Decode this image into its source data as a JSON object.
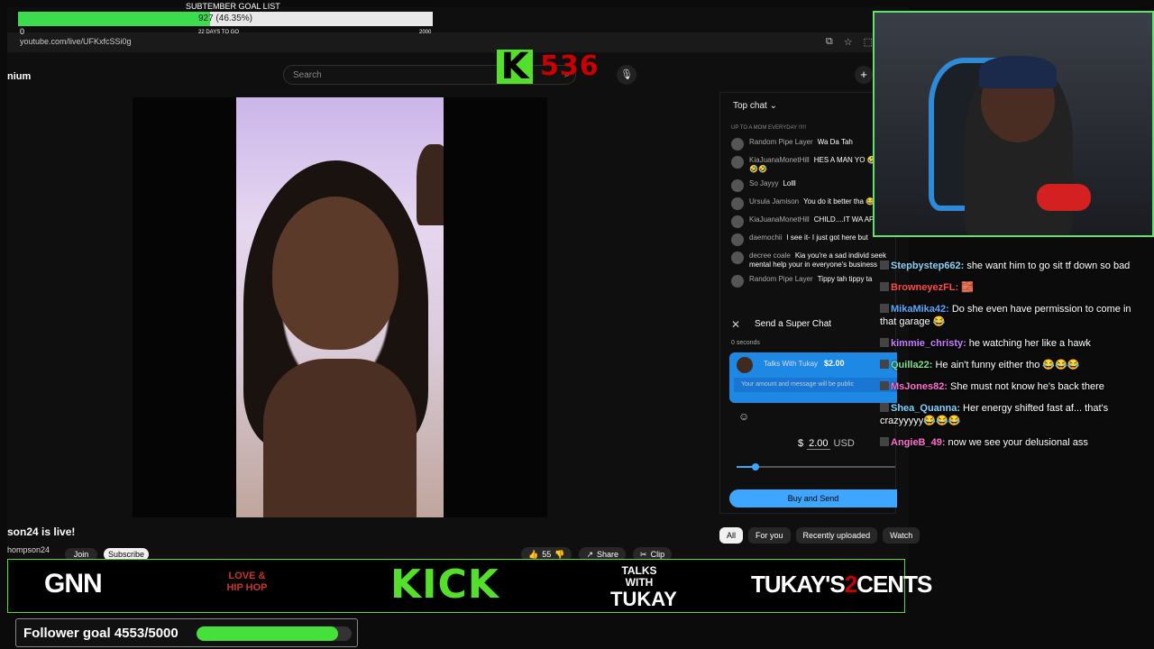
{
  "goal": {
    "label": "SUBTEMBER GOAL LIST",
    "progress_text": "927 (46.35%)",
    "current": 927,
    "max_label": "2000",
    "min_label": "0",
    "days_left": "22 DAYS TO GO",
    "fraction": 0.4635
  },
  "browser": {
    "url": "youtube.com/live/UFKxfcSSi0g"
  },
  "youtube": {
    "brand": "nium",
    "search_placeholder": "Search",
    "video_title": "son24 is live!",
    "channel": "hompson24",
    "join_label": "Join",
    "subscribe_label": "Subscribe",
    "likes": "55",
    "share_label": "Share",
    "clip_label": "Clip"
  },
  "kick_overlay": {
    "badge": "K",
    "viewer_count": "536"
  },
  "chat": {
    "header": "Top chat",
    "top_fragment": "UP TO A MOM EVERYDAY !!!!!",
    "messages": [
      {
        "name": "Random Pipe Layer",
        "text": "Wa Da Tah"
      },
      {
        "name": "KiaJuanaMonetHill",
        "text": "HES A MAN YO 🤣🤣🤣🤣"
      },
      {
        "name": "So Jayyy",
        "text": "Lolll"
      },
      {
        "name": "Ursula Jamison",
        "text": "You do it better tha 😂😅"
      },
      {
        "name": "KiaJuanaMonetHill",
        "text": "CHILD....IT WA APART"
      },
      {
        "name": "daemochii",
        "text": "I see it- I just got here but"
      },
      {
        "name": "decree coale",
        "text": "Kia you're a sad individ seek mental help your in everyone's business"
      },
      {
        "name": "Random Pipe Layer",
        "text": "Tippy tah tippy ta"
      }
    ],
    "superchat": {
      "title": "Send a Super Chat",
      "seconds": "0 seconds",
      "card_name": "Talks With Tukay",
      "card_amount": "$2.00",
      "card_placeholder": "Your amount and message will be public",
      "currency_symbol": "$",
      "amount_value": "2.00",
      "currency": "USD",
      "slider_fraction": 0.12,
      "buy_label": "Buy and Send"
    },
    "chips": [
      "All",
      "For you",
      "Recently uploaded",
      "Watch"
    ]
  },
  "side_chat": [
    {
      "name": "Stepbystep662:",
      "color": "#8fd3f4",
      "text": "she want him to go sit tf down so bad"
    },
    {
      "name": "BrowneyezFL:",
      "color": "#ff4a4a",
      "text": "🧱"
    },
    {
      "name": "MikaMika42:",
      "color": "#5aa8ff",
      "text": "Do she even have permission to come in that garage 😂"
    },
    {
      "name": "kimmie_christy:",
      "color": "#c77dff",
      "text": "he watching her like a hawk"
    },
    {
      "name": "Quilla22:",
      "color": "#7ee08a",
      "text": "He ain't funny either tho 😂😂😂"
    },
    {
      "name": "MsJones82:",
      "color": "#ff6fd0",
      "text": "She must not know he's back there"
    },
    {
      "name": "Shea_Quanna:",
      "color": "#7fd4ff",
      "text": "Her energy shifted fast af... that's crazyyyyy😂😂😂"
    },
    {
      "name": "AngieB_49:",
      "color": "#ff6fd0",
      "text": "now we see your delusional ass"
    }
  ],
  "logos": {
    "gnn": "GNN",
    "love": "LOVE & HIP HOP",
    "kick": "KICK",
    "tukay_small": "TALKS WITH",
    "tukay_big": "TUKAY",
    "cents_a": "TUKAY'S",
    "cents_two": "2",
    "cents_b": "CENTS"
  },
  "follower_goal": {
    "label": "Follower goal 4553/5000",
    "current": 4553,
    "target": 5000,
    "fraction": 0.91
  },
  "colors": {
    "accent_green": "#54e02a",
    "youtube_blue": "#3ea6ff",
    "kick_count_red": "#cc0000"
  }
}
